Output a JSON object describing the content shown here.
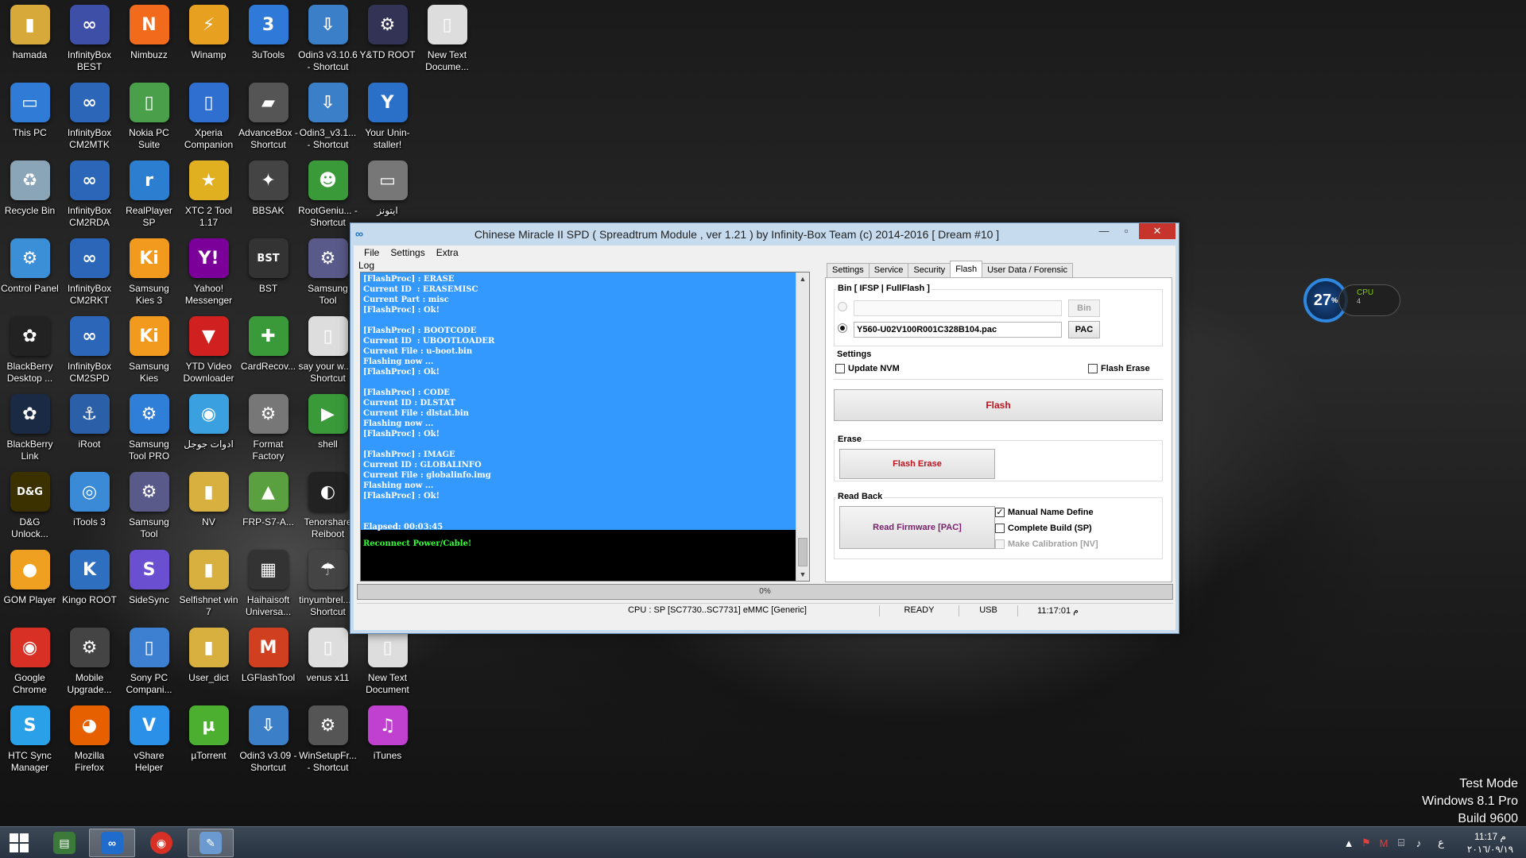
{
  "desktop": {
    "icons": [
      {
        "label": "hamada",
        "glyph": "▮",
        "color": "#d7a93a"
      },
      {
        "label": "This PC",
        "glyph": "▭",
        "color": "#2f7bd6"
      },
      {
        "label": "Recycle Bin",
        "glyph": "♻",
        "color": "#8aa5b8"
      },
      {
        "label": "Control Panel",
        "glyph": "⚙",
        "color": "#3b8fd6"
      },
      {
        "label": "BlackBerry Desktop ...",
        "glyph": "✿",
        "color": "#222222"
      },
      {
        "label": "BlackBerry Link",
        "glyph": "✿",
        "color": "#1a2a44"
      },
      {
        "label": "D&G Unlock...",
        "glyph": "D&G",
        "color": "#3a3000"
      },
      {
        "label": "GOM Player",
        "glyph": "●",
        "color": "#f0a020"
      },
      {
        "label": "Google Chrome",
        "glyph": "◉",
        "color": "#d93025"
      },
      {
        "label": "HTC Sync Manager",
        "glyph": "S",
        "color": "#2aa0e8"
      },
      {
        "label": "InfinityBox BEST",
        "glyph": "∞",
        "color": "#3e4fa8"
      },
      {
        "label": "InfinityBox CM2MTK",
        "glyph": "∞",
        "color": "#2b66b8"
      },
      {
        "label": "InfinityBox CM2RDA",
        "glyph": "∞",
        "color": "#2b66b8"
      },
      {
        "label": "InfinityBox CM2RKT",
        "glyph": "∞",
        "color": "#2b66b8"
      },
      {
        "label": "InfinityBox CM2SPD",
        "glyph": "∞",
        "color": "#2b66b8"
      },
      {
        "label": "iRoot",
        "glyph": "⚓",
        "color": "#2b5fa8"
      },
      {
        "label": "iTools 3",
        "glyph": "◎",
        "color": "#3a8ad8"
      },
      {
        "label": "Kingo ROOT",
        "glyph": "K",
        "color": "#2f6fc0"
      },
      {
        "label": "Mobile Upgrade...",
        "glyph": "⚙",
        "color": "#444444"
      },
      {
        "label": "Mozilla Firefox",
        "glyph": "◕",
        "color": "#e66000"
      },
      {
        "label": "Nimbuzz",
        "glyph": "N",
        "color": "#f26a1b"
      },
      {
        "label": "Nokia PC Suite",
        "glyph": "▯",
        "color": "#4aa04a"
      },
      {
        "label": "RealPlayer SP",
        "glyph": "r",
        "color": "#2c7fd0"
      },
      {
        "label": "Samsung Kies 3",
        "glyph": "Ki",
        "color": "#f29a1e"
      },
      {
        "label": "Samsung Kies",
        "glyph": "Ki",
        "color": "#f29a1e"
      },
      {
        "label": "Samsung Tool PRO",
        "glyph": "⚙",
        "color": "#2f7ed8"
      },
      {
        "label": "Samsung Tool",
        "glyph": "⚙",
        "color": "#5a5a8a"
      },
      {
        "label": "SideSync",
        "glyph": "S",
        "color": "#6a4fd0"
      },
      {
        "label": "Sony PC Compani...",
        "glyph": "▯",
        "color": "#3d7fd0"
      },
      {
        "label": "vShare Helper",
        "glyph": "V",
        "color": "#2a90e8"
      },
      {
        "label": "Winamp",
        "glyph": "⚡",
        "color": "#e8a020"
      },
      {
        "label": "Xperia Companion",
        "glyph": "▯",
        "color": "#2f6fd0"
      },
      {
        "label": "XTC 2 Tool 1.17",
        "glyph": "★",
        "color": "#e0b020"
      },
      {
        "label": "Yahoo! Messenger",
        "glyph": "Y!",
        "color": "#7b0099"
      },
      {
        "label": "YTD Video Downloader",
        "glyph": "▼",
        "color": "#d02020"
      },
      {
        "label": "ادوات جوجل",
        "glyph": "◉",
        "color": "#3aa0e0"
      },
      {
        "label": "NV",
        "glyph": "▮",
        "color": "#d7b040"
      },
      {
        "label": "Selfishnet win 7",
        "glyph": "▮",
        "color": "#d7b040"
      },
      {
        "label": "User_dict",
        "glyph": "▮",
        "color": "#d7b040"
      },
      {
        "label": "µTorrent",
        "glyph": "µ",
        "color": "#4caf30"
      },
      {
        "label": "3uTools",
        "glyph": "3",
        "color": "#2f7ad8"
      },
      {
        "label": "AdvanceBox - Shortcut",
        "glyph": "▰",
        "color": "#555555"
      },
      {
        "label": "BBSAK",
        "glyph": "✦",
        "color": "#444444"
      },
      {
        "label": "BST",
        "glyph": "BST",
        "color": "#333333"
      },
      {
        "label": "CardRecov...",
        "glyph": "✚",
        "color": "#3a9a3a"
      },
      {
        "label": "Format Factory",
        "glyph": "⚙",
        "color": "#777777"
      },
      {
        "label": "FRP-S7-A...",
        "glyph": "▲",
        "color": "#5aa040"
      },
      {
        "label": "Haihaisoft Universa...",
        "glyph": "▦",
        "color": "#333333"
      },
      {
        "label": "LGFlashTool",
        "glyph": "M",
        "color": "#d04020"
      },
      {
        "label": "Odin3 v3.09 - Shortcut",
        "glyph": "⇩",
        "color": "#3a7fc8"
      },
      {
        "label": "Odin3 v3.10.6 - Shortcut",
        "glyph": "⇩",
        "color": "#3a7fc8"
      },
      {
        "label": "Odin3_v3.1... - Shortcut",
        "glyph": "⇩",
        "color": "#3a7fc8"
      },
      {
        "label": "RootGeniu... - Shortcut",
        "glyph": "☻",
        "color": "#3a9a3a"
      },
      {
        "label": "Samsung Tool",
        "glyph": "⚙",
        "color": "#5a5a8a"
      },
      {
        "label": "say your w... - Shortcut",
        "glyph": "▯",
        "color": "#dddddd"
      },
      {
        "label": "shell",
        "glyph": "▶",
        "color": "#3a9a3a"
      },
      {
        "label": "Tenorshare Reiboot",
        "glyph": "◐",
        "color": "#222222"
      },
      {
        "label": "tinyumbrel... - Shortcut",
        "glyph": "☂",
        "color": "#444444"
      },
      {
        "label": "venus x11",
        "glyph": "▯",
        "color": "#dddddd"
      },
      {
        "label": "WinSetupFr... - Shortcut",
        "glyph": "⚙",
        "color": "#555555"
      },
      {
        "label": "Y&TD ROOT",
        "glyph": "⚙",
        "color": "#333355"
      },
      {
        "label": "Your Unin-staller!",
        "glyph": "Y",
        "color": "#2a70c8"
      },
      {
        "label": "ايتونز",
        "glyph": "▭",
        "color": "#777777"
      },
      {
        "label": "",
        "glyph": "",
        "color": "transparent"
      },
      {
        "label": "",
        "glyph": "",
        "color": "transparent"
      },
      {
        "label": "",
        "glyph": "",
        "color": "transparent"
      },
      {
        "label": "",
        "glyph": "",
        "color": "transparent"
      },
      {
        "label": "",
        "glyph": "",
        "color": "transparent"
      },
      {
        "label": "New Text Document",
        "glyph": "▯",
        "color": "#dddddd"
      },
      {
        "label": "iTunes",
        "glyph": "♫",
        "color": "#c040d0"
      },
      {
        "label": "New Text Docume...",
        "glyph": "▯",
        "color": "#dddddd"
      }
    ]
  },
  "cpu_gadget": {
    "percent": "27",
    "unit": "%",
    "label": "CPU",
    "sub": "4"
  },
  "watermark": {
    "line1": "Test Mode",
    "line2": "Windows 8.1 Pro",
    "line3": "Build 9600"
  },
  "window": {
    "title": "Chinese Miracle II SPD ( Spreadtrum Module , ver 1.21 ) by Infinity-Box Team (c) 2014-2016 [ Dream #10 ]",
    "menu": [
      "File",
      "Settings",
      "Extra"
    ],
    "log_label": "Log",
    "log_lines": [
      "[FlashProc] : ERASE",
      "Current ID  : ERASEMISC",
      "Current Part : misc",
      "[FlashProc] : Ok!",
      "",
      "[FlashProc] : BOOTCODE",
      "Current ID  : UBOOTLOADER",
      "Current File : u-boot.bin",
      "Flashing now ...",
      "[FlashProc] : Ok!",
      "",
      "[FlashProc] : CODE",
      "Current ID : DLSTAT",
      "Current File : dlstat.bin",
      "Flashing now ...",
      "[FlashProc] : Ok!",
      "",
      "[FlashProc] : IMAGE",
      "Current ID : GLOBALINFO",
      "Current File : globalinfo.img",
      "Flashing now ...",
      "[FlashProc] : Ok!",
      "",
      "",
      "Elapsed: 00:03:45"
    ],
    "log_highlight": "Reconnect Power/Cable!",
    "tabs": [
      "Settings",
      "Service",
      "Security",
      "Flash",
      "User Data / Forensic"
    ],
    "active_tab": "Flash",
    "bin_group": {
      "title": "Bin  [ IFSP | FullFlash ]",
      "bin_value": "",
      "bin_button": "Bin",
      "pac_value": "Y560-U02V100R001C328B104.pac",
      "pac_button": "PAC"
    },
    "settings_group": {
      "title": "Settings",
      "update_nvm": "Update NVM",
      "flash_erase": "Flash Erase"
    },
    "flash_button": "Flash",
    "erase_group": {
      "title": "Erase",
      "button": "Flash Erase"
    },
    "readback_group": {
      "title": "Read Back",
      "button": "Read Firmware [PAC]",
      "manual_name": "Manual Name Define",
      "complete_build": "Complete Build (SP)",
      "make_calibration": "Make Calibration [NV]"
    },
    "progress": "0%",
    "status": {
      "cpu": "CPU : SP [SC7730..SC7731] eMMC [Generic]",
      "state": "READY",
      "conn": "USB",
      "time": "11:17:01 م"
    }
  },
  "taskbar": {
    "lang": "ع",
    "time": "11:17 م",
    "date": "٢٠١٦/٠٩/١٩"
  }
}
